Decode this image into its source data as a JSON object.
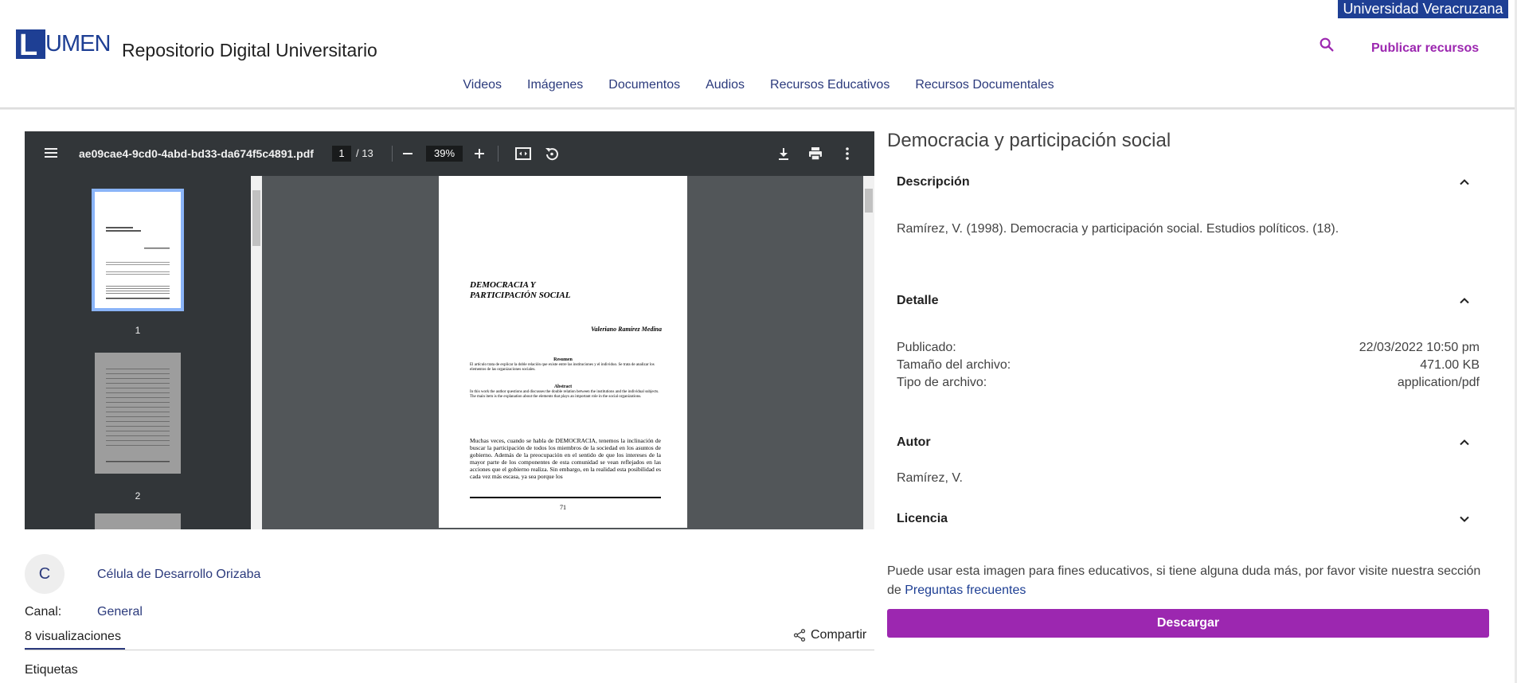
{
  "header": {
    "university": "Universidad Veracruzana",
    "logo_letter": "L",
    "logo_rest": "UMEN",
    "site_title": "Repositorio Digital Universitario",
    "publish_label": "Publicar recursos",
    "accent_color": "#9c27b0",
    "brand_color": "#1e3f94"
  },
  "nav": {
    "items": [
      "Videos",
      "Imágenes",
      "Documentos",
      "Audios",
      "Recursos Educativos",
      "Recursos Documentales"
    ]
  },
  "viewer": {
    "filename": "ae09cae4-9cd0-4abd-bd33-da674f5c4891.pdf",
    "current_page": "1",
    "total_pages": "/ 13",
    "zoom": "39%",
    "thumbnails": [
      {
        "label": "1"
      },
      {
        "label": "2"
      }
    ],
    "page": {
      "title_line1": "DEMOCRACIA Y",
      "title_line2": "PARTICIPACIÓN SOCIAL",
      "author": "Valeriano Ramírez Medina",
      "resumen_head": "Resumen",
      "resumen_text": "El artículo trata de explicar la doble relación que existe entre las instituciones y el individuo. Se trata de analizar los elementos de las organizaciones sociales.",
      "abstract_head": "Abstract",
      "abstract_text": "In this work the author questions and discusses the double relation between the institutions and the individual subjects. The main item is the explanation about the elements that plays an important role in the social organizations.",
      "body_text": "Muchas veces, cuando se habla de DEMOCRACIA, tenemos la inclinación de buscar la participación de todos los miembros de la sociedad en los asuntos de gobierno. Además de la preocupación en el sentido de que los intereses de la mayor parte de los componentes de esta comunidad se vean reflejados en las acciones que el gobierno realiza. Sin embargo, en la realidad esta posibilidad es cada vez más escasa, ya sea porque los",
      "page_number": "71"
    }
  },
  "channel": {
    "avatar_letter": "C",
    "owner": "Célula de Desarrollo Orizaba",
    "canal_label": "Canal:",
    "canal_value": "General",
    "views": "8 visualizaciones",
    "share_label": "Compartir",
    "tags_label": "Etiquetas"
  },
  "details": {
    "title": "Democracia y participación social",
    "description_head": "Descripción",
    "description_text": "Ramírez, V. (1998). Democracia y participación social. Estudios políticos. (18).",
    "detail_head": "Detalle",
    "published_label": "Publicado:",
    "published_value": "22/03/2022 10:50 pm",
    "size_label": "Tamaño del archivo:",
    "size_value": "471.00 KB",
    "type_label": "Tipo de archivo:",
    "type_value": "application/pdf",
    "author_head": "Autor",
    "author_value": "Ramírez, V.",
    "license_head": "Licencia",
    "notice_text": "Puede usar esta imagen para fines educativos, si tiene alguna duda más, por favor visite nuestra sección de",
    "faq_link": "Preguntas frecuentes",
    "download_label": "Descargar"
  }
}
